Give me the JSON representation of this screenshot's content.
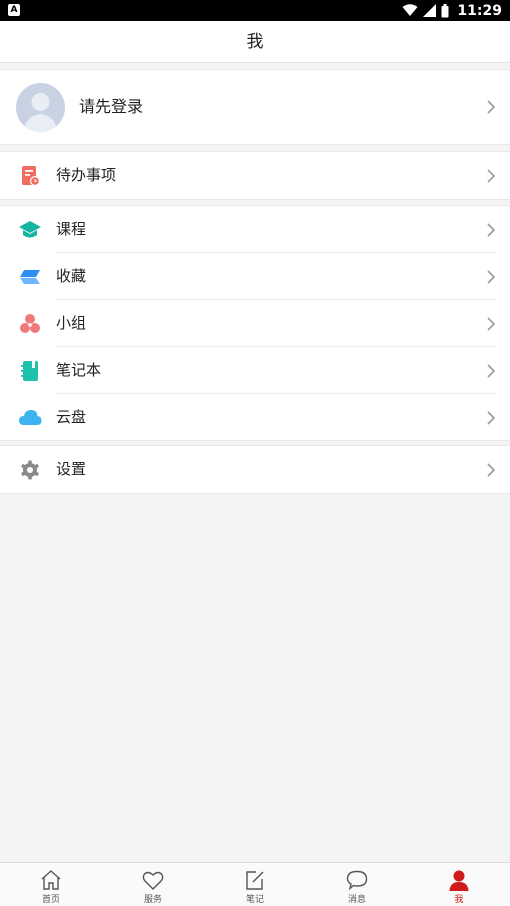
{
  "status_bar": {
    "time": "11:29",
    "notification_badge": "A"
  },
  "header": {
    "title": "我"
  },
  "profile": {
    "login_prompt": "请先登录"
  },
  "todo": {
    "label": "待办事项",
    "icon": "todo-icon",
    "color": "#f06c5f"
  },
  "menu": [
    {
      "label": "课程",
      "icon": "graduation-cap-icon",
      "color": "#13b5a0"
    },
    {
      "label": "收藏",
      "icon": "favorites-icon",
      "color": "#2d8ff0"
    },
    {
      "label": "小组",
      "icon": "group-icon",
      "color": "#f07a7a"
    },
    {
      "label": "笔记本",
      "icon": "notebook-icon",
      "color": "#1ec1a9"
    },
    {
      "label": "云盘",
      "icon": "cloud-icon",
      "color": "#3db3f2"
    }
  ],
  "settings": {
    "label": "设置",
    "icon": "gear-icon",
    "color": "#8a8a8a"
  },
  "tabs": [
    {
      "label": "首页",
      "icon": "home-icon",
      "active": false
    },
    {
      "label": "服务",
      "icon": "heart-icon",
      "active": false
    },
    {
      "label": "笔记",
      "icon": "edit-icon",
      "active": false
    },
    {
      "label": "消息",
      "icon": "chat-bubble-icon",
      "active": false
    },
    {
      "label": "我",
      "icon": "person-icon",
      "active": true
    }
  ],
  "colors": {
    "accent": "#d11a1a",
    "background": "#f3f4f6"
  }
}
